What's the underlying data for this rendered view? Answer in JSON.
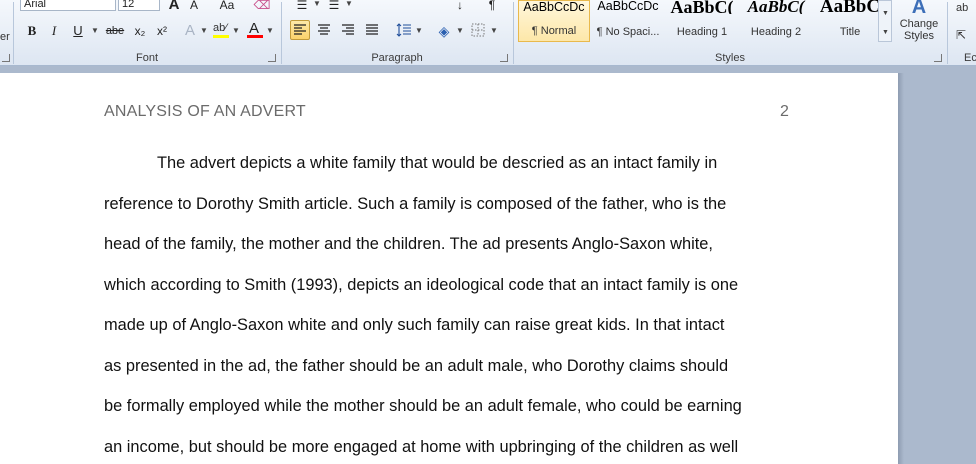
{
  "ribbon": {
    "font_group": {
      "label": "Font",
      "font_name": "Arial",
      "font_size": "12",
      "bold": "B",
      "italic": "I",
      "underline": "U",
      "strike": "abe",
      "subscript": "x₂",
      "superscript": "x²",
      "grow": "A",
      "shrink": "A",
      "case": "Aa"
    },
    "paragraph_group": {
      "label": "Paragraph"
    },
    "styles_group": {
      "label": "Styles",
      "tiles": [
        {
          "sample": "AaBbCcDc",
          "name": "¶ Normal"
        },
        {
          "sample": "AaBbCcDc",
          "name": "¶ No Spaci..."
        },
        {
          "sample": "AaBbC(",
          "name": "Heading 1"
        },
        {
          "sample": "AaBbC(",
          "name": "Heading 2"
        },
        {
          "sample": "AaBbC",
          "name": "Title"
        }
      ],
      "change_styles": "Change Styles"
    },
    "editing_group": {
      "label": "Ec"
    },
    "clipboard_fragment": "er"
  },
  "document": {
    "header": "ANALYSIS OF AN ADVERT",
    "page_number": "2",
    "lines": [
      "The advert depicts a white family that would be descried as an intact family in",
      "reference to Dorothy Smith article. Such a family is composed of the father, who is the",
      "head of the family, the mother and the children. The ad presents Anglo-Saxon white,",
      "which according to Smith (1993), depicts an ideological code that an intact family is one",
      "made up of Anglo-Saxon white and only such family can raise great kids.  In that intact",
      "as presented in the ad, the father should be an adult male, who Dorothy claims should",
      "be formally employed while the mother should be an adult female, who could be earning",
      "an income, but should be more engaged at home with upbringing of the children as well"
    ]
  },
  "colors": {
    "ribbon_bg": "#dde6f2",
    "workspace": "#abb9cd",
    "highlight": "#ffff00",
    "font_color": "#ff0000"
  }
}
